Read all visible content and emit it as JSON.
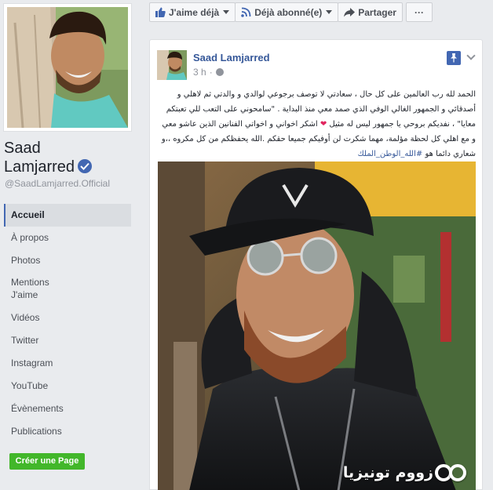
{
  "page": {
    "name_line1": "Saad",
    "name_line2": "Lamjarred",
    "handle": "@SaadLamjarred.Official"
  },
  "nav": {
    "items": [
      {
        "label": "Accueil",
        "active": true
      },
      {
        "label": "À propos"
      },
      {
        "label": "Photos"
      },
      {
        "label": "Mentions J'aime"
      },
      {
        "label": "Vidéos"
      },
      {
        "label": "Twitter"
      },
      {
        "label": "Instagram"
      },
      {
        "label": "YouTube"
      },
      {
        "label": "Évènements"
      },
      {
        "label": "Publications"
      }
    ],
    "create_page": "Créer une Page"
  },
  "action_bar": {
    "like": "J'aime déjà",
    "follow": "Déjà abonné(e)",
    "share": "Partager",
    "more": "···"
  },
  "post": {
    "author": "Saad Lamjarred",
    "time": "3 h",
    "dot": "·",
    "text_1": "الحمد لله رب العالمين على كل حال ، سعادتي لا توصف برجوعي لوالدي و والدتي ثم لاهلي و أصدقائي و الجمهور الغالي الوفي الذي صمد معي منذ البداية . \"سامحوني على التعب للي تعبتكم معايا\" ، نفديكم بروحي يا جمهور ليس له مثيل ",
    "heart": "❤",
    "text_2": " اشكر اخواني و اخواتي الفنانين الذين عاشو معي و مع اهلي كل لحظة مؤلمة، مهما شكرت لن أوفيكم جميعا حقكم .الله يحفظكم من كل مكروه ،،و شعاري دائما هو ",
    "hashtag": "#الله_الوطن_الملك"
  },
  "watermark": {
    "text": "زووم تونيزيا"
  },
  "colors": {
    "brand_blue": "#4267b2",
    "link_blue": "#365899",
    "create_green": "#42b72a",
    "background": "#e9ebee"
  },
  "icons": [
    "verified-badge-icon",
    "thumbs-up-icon",
    "rss-icon",
    "share-arrow-icon",
    "pin-icon",
    "globe-icon",
    "chevron-down-icon"
  ]
}
